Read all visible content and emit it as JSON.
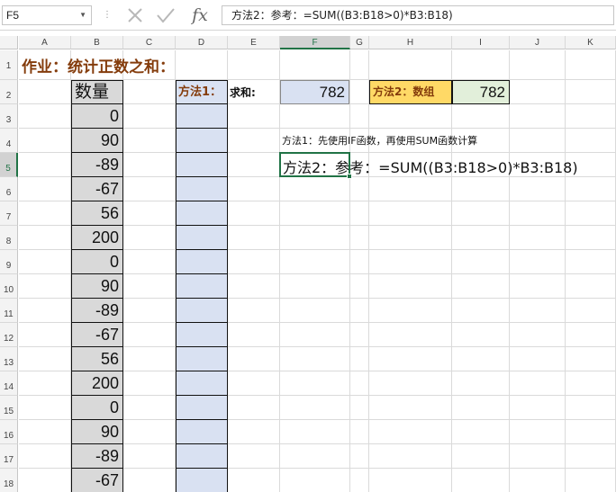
{
  "formula_bar": {
    "name_box": "F5",
    "formula": "方法2：参考：=SUM((B3:B18>0)*B3:B18)",
    "cancel_icon": "x-icon",
    "enter_icon": "check-icon",
    "fx_label": "fx"
  },
  "columns": [
    "A",
    "B",
    "C",
    "D",
    "E",
    "F",
    "G",
    "H",
    "I",
    "J",
    "K"
  ],
  "selected_column": "F",
  "rows": [
    "1",
    "2",
    "3",
    "4",
    "5",
    "6",
    "7",
    "8",
    "9",
    "10",
    "11",
    "12",
    "13",
    "14",
    "15",
    "16",
    "17",
    "18"
  ],
  "selected_row": "5",
  "sheet": {
    "title": "作业：统计正数之和：",
    "b_header": "数量",
    "b_values": [
      "0",
      "90",
      "-89",
      "-67",
      "56",
      "200",
      "0",
      "90",
      "-89",
      "-67",
      "56",
      "200",
      "0",
      "90",
      "-89",
      "-67"
    ],
    "d_header": "方法1：",
    "sum_label": "求和:",
    "f2_value": "782",
    "h2_label": "方法2：数组",
    "i2_value": "782",
    "note_method1": "方法1：先使用IF函数，再使用SUM函数计算",
    "note_method2": "方法2：参考：=SUM((B3:B18>0)*B3:B18)"
  },
  "colors": {
    "title_color": "#843c0c",
    "b_fill": "#d9d9d9",
    "d_fill": "#d9e1f2",
    "h2_fill": "#ffd966",
    "i2_fill": "#e2efda",
    "selection": "#217346"
  }
}
